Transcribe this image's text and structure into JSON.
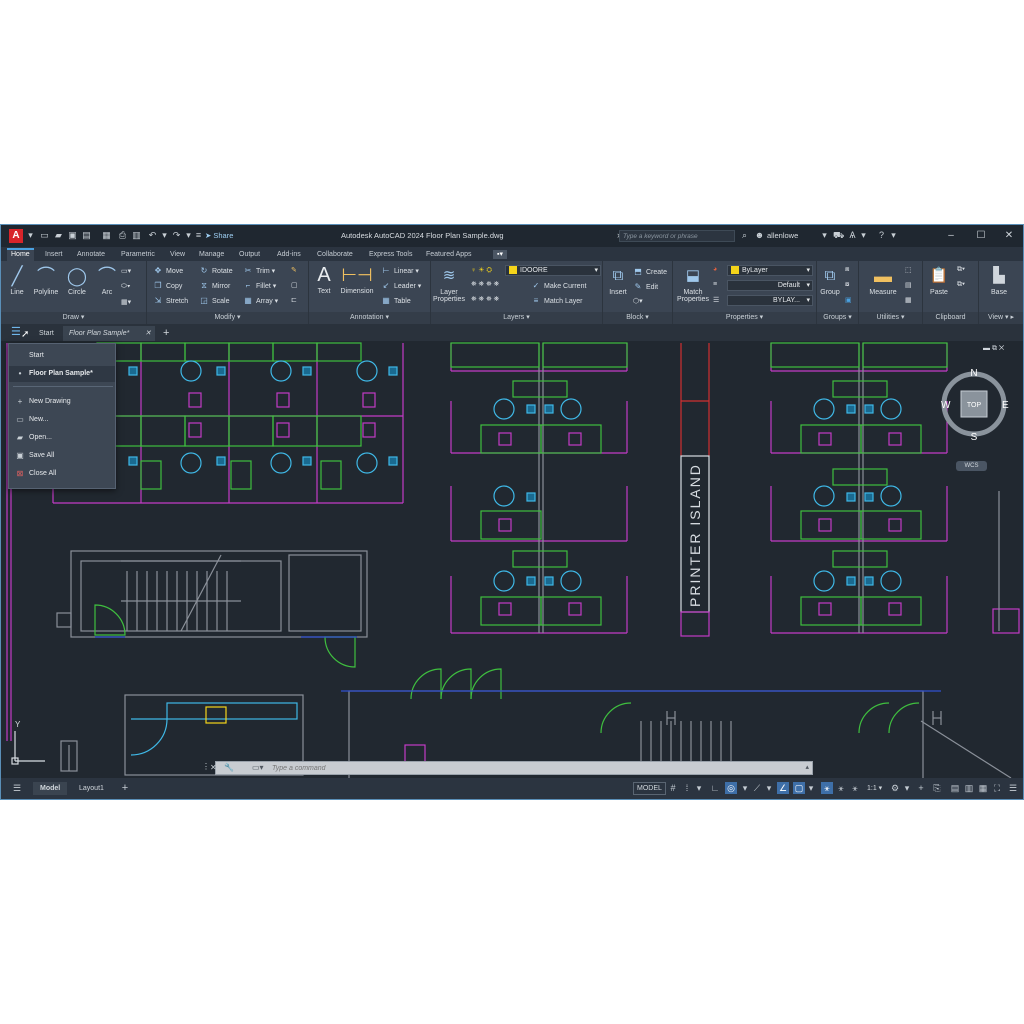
{
  "app": {
    "logo_letter": "A",
    "title": "Autodesk AutoCAD 2024    Floor Plan Sample.dwg",
    "share_label": "Share",
    "search_placeholder": "Type a keyword or phrase",
    "user_name": "allenlowe"
  },
  "ribbon_tabs": [
    "Home",
    "Insert",
    "Annotate",
    "Parametric",
    "View",
    "Manage",
    "Output",
    "Add-ins",
    "Collaborate",
    "Express Tools",
    "Featured Apps"
  ],
  "ribbon": {
    "draw": {
      "label": "Draw",
      "line": "Line",
      "polyline": "Polyline",
      "circle": "Circle",
      "arc": "Arc"
    },
    "modify": {
      "label": "Modify",
      "move": "Move",
      "copy": "Copy",
      "stretch": "Stretch",
      "rotate": "Rotate",
      "mirror": "Mirror",
      "scale": "Scale",
      "trim": "Trim",
      "fillet": "Fillet",
      "array": "Array"
    },
    "annotation": {
      "label": "Annotation",
      "text": "Text",
      "dimension": "Dimension",
      "linear": "Linear",
      "leader": "Leader",
      "table": "Table"
    },
    "layers": {
      "label": "Layers",
      "layer_properties_1": "Layer",
      "layer_properties_2": "Properties",
      "current_layer": "IDOORE",
      "make_current": "Make Current",
      "match_layer": "Match Layer"
    },
    "block": {
      "label": "Block",
      "insert": "Insert",
      "create": "Create",
      "edit": "Edit"
    },
    "properties": {
      "label": "Properties",
      "match_1": "Match",
      "match_2": "Properties",
      "color": "ByLayer",
      "linetype": "Default",
      "lineweight": "BYLAY..."
    },
    "groups": {
      "label": "Groups",
      "group": "Group"
    },
    "utilities": {
      "label": "Utilities",
      "measure": "Measure"
    },
    "clipboard": {
      "label": "Clipboard",
      "paste": "Paste"
    },
    "view": {
      "label": "View",
      "base": "Base"
    }
  },
  "file_tabs": {
    "start": "Start",
    "current": "Floor Plan Sample*"
  },
  "app_menu": {
    "items_top": [
      "Start",
      "Floor Plan Sample*"
    ],
    "items_actions": [
      "New Drawing",
      "New...",
      "Open...",
      "Save All",
      "Close All"
    ]
  },
  "drawing": {
    "printer_label": "PRINTER ISLAND",
    "ucs_y": "Y"
  },
  "viewcube": {
    "n": "N",
    "s": "S",
    "e": "E",
    "w": "W",
    "face": "TOP",
    "wcs": "WCS"
  },
  "command_line": {
    "placeholder": "Type a command"
  },
  "status_bar": {
    "model_tab": "Model",
    "layout_tab": "Layout1",
    "model_button": "MODEL",
    "scale": "1:1"
  },
  "colors": {
    "accent": "#4aa1e0",
    "background": "#212830",
    "walls_magenta": "#c23bc6",
    "furniture_green": "#3fbf3f",
    "chairs_cyan": "#3fb8e6",
    "current_layer_yellow": "#f4d41a"
  }
}
